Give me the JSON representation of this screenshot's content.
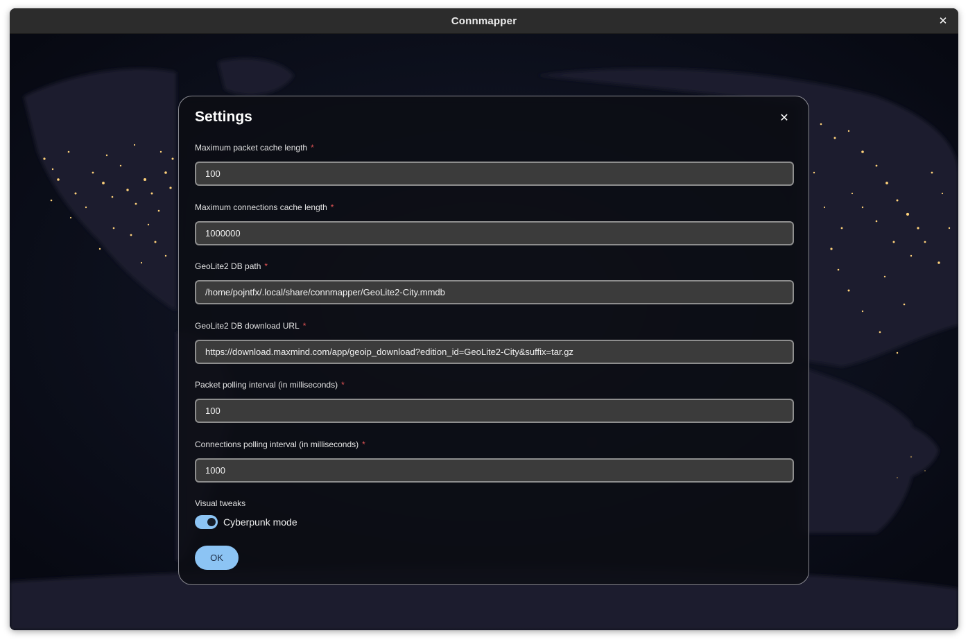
{
  "window": {
    "title": "Connmapper",
    "close_glyph": "✕"
  },
  "dialog": {
    "title": "Settings",
    "close_glyph": "✕",
    "required_marker": "*",
    "fields": [
      {
        "label": "Maximum packet cache length",
        "value": "100"
      },
      {
        "label": "Maximum connections cache length",
        "value": "1000000"
      },
      {
        "label": "GeoLite2 DB path",
        "value": "/home/pojntfx/.local/share/connmapper/GeoLite2-City.mmdb"
      },
      {
        "label": "GeoLite2 DB download URL",
        "value": "https://download.maxmind.com/app/geoip_download?edition_id=GeoLite2-City&suffix=tar.gz"
      },
      {
        "label": "Packet polling interval (in milliseconds)",
        "value": "100"
      },
      {
        "label": "Connections polling interval (in milliseconds)",
        "value": "1000"
      }
    ],
    "visual_tweaks_label": "Visual tweaks",
    "cyberpunk_toggle": {
      "label": "Cyberpunk mode",
      "checked": true
    },
    "ok_label": "OK"
  },
  "colors": {
    "accent": "#8cc4f4",
    "required": "#e35454",
    "city_lights": "#ffd27a"
  }
}
